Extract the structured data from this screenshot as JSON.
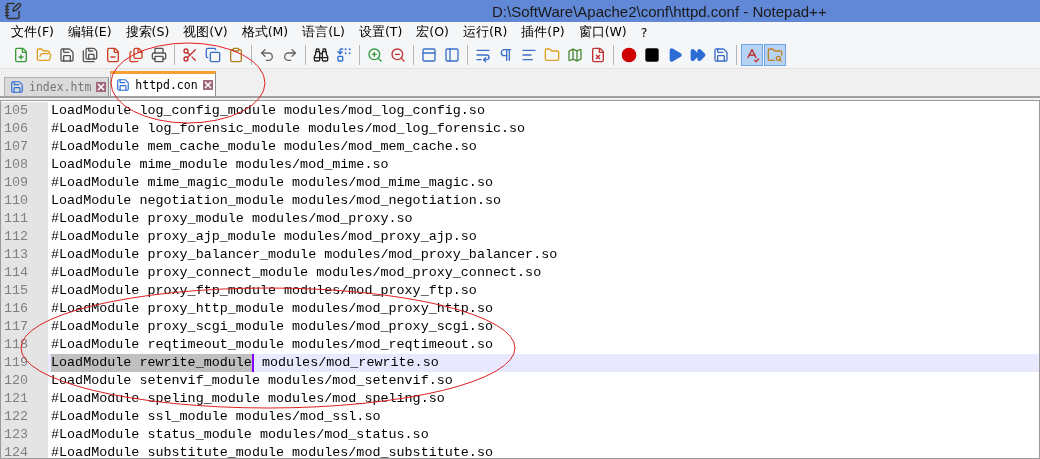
{
  "window": {
    "title": "D:\\SoftWare\\Apache2\\conf\\httpd.conf - Notepad++"
  },
  "menu": [
    "文件(F)",
    "编辑(E)",
    "搜索(S)",
    "视图(V)",
    "格式(M)",
    "语言(L)",
    "设置(T)",
    "宏(O)",
    "运行(R)",
    "插件(P)",
    "窗口(W)",
    "?"
  ],
  "toolbar": [
    {
      "kind": "new",
      "pressed": false
    },
    {
      "kind": "open",
      "pressed": false
    },
    {
      "kind": "save",
      "pressed": false
    },
    {
      "kind": "save-all",
      "pressed": false
    },
    {
      "kind": "close",
      "pressed": false
    },
    {
      "kind": "close-all",
      "pressed": false
    },
    {
      "kind": "print",
      "pressed": false
    },
    {
      "kind": "separator"
    },
    {
      "kind": "cut",
      "pressed": false
    },
    {
      "kind": "copy",
      "pressed": false
    },
    {
      "kind": "paste",
      "pressed": false
    },
    {
      "kind": "separator"
    },
    {
      "kind": "undo",
      "pressed": false
    },
    {
      "kind": "redo",
      "pressed": false
    },
    {
      "kind": "separator"
    },
    {
      "kind": "find",
      "pressed": false
    },
    {
      "kind": "replace",
      "pressed": false
    },
    {
      "kind": "separator"
    },
    {
      "kind": "zoom-in",
      "pressed": false
    },
    {
      "kind": "zoom-out",
      "pressed": false
    },
    {
      "kind": "separator"
    },
    {
      "kind": "sync-vertical",
      "pressed": false
    },
    {
      "kind": "sync-horizontal",
      "pressed": false
    },
    {
      "kind": "separator"
    },
    {
      "kind": "wrap",
      "pressed": false
    },
    {
      "kind": "all-chars",
      "pressed": false
    },
    {
      "kind": "indent-guide",
      "pressed": false
    },
    {
      "kind": "language",
      "pressed": false
    },
    {
      "kind": "doc-map",
      "pressed": false
    },
    {
      "kind": "function-list",
      "pressed": false
    },
    {
      "kind": "separator"
    },
    {
      "kind": "record",
      "pressed": false
    },
    {
      "kind": "stop",
      "pressed": false
    },
    {
      "kind": "play",
      "pressed": false
    },
    {
      "kind": "play-multiple",
      "pressed": false
    },
    {
      "kind": "save-macro",
      "pressed": false
    },
    {
      "kind": "separator"
    },
    {
      "kind": "spellcheck",
      "pressed": true
    },
    {
      "kind": "folder",
      "pressed": true
    }
  ],
  "tabs": [
    {
      "label": "index.htm",
      "selected": false
    },
    {
      "label": "httpd.con",
      "selected": true
    }
  ],
  "editor": {
    "lines": [
      {
        "number": "105",
        "current": false,
        "parts": [
          {
            "text": "LoadModule log_config_module modules/mod_log_config.so",
            "selected": false
          }
        ]
      },
      {
        "number": "106",
        "current": false,
        "parts": [
          {
            "text": "#LoadModule log_forensic_module modules/mod_log_forensic.so",
            "selected": false
          }
        ]
      },
      {
        "number": "107",
        "current": false,
        "parts": [
          {
            "text": "#LoadModule mem_cache_module modules/mod_mem_cache.so",
            "selected": false
          }
        ]
      },
      {
        "number": "108",
        "current": false,
        "parts": [
          {
            "text": "LoadModule mime_module modules/mod_mime.so",
            "selected": false
          }
        ]
      },
      {
        "number": "109",
        "current": false,
        "parts": [
          {
            "text": "#LoadModule mime_magic_module modules/mod_mime_magic.so",
            "selected": false
          }
        ]
      },
      {
        "number": "110",
        "current": false,
        "parts": [
          {
            "text": "LoadModule negotiation_module modules/mod_negotiation.so",
            "selected": false
          }
        ]
      },
      {
        "number": "111",
        "current": false,
        "parts": [
          {
            "text": "#LoadModule proxy_module modules/mod_proxy.so",
            "selected": false
          }
        ]
      },
      {
        "number": "112",
        "current": false,
        "parts": [
          {
            "text": "#LoadModule proxy_ajp_module modules/mod_proxy_ajp.so",
            "selected": false
          }
        ]
      },
      {
        "number": "113",
        "current": false,
        "parts": [
          {
            "text": "#LoadModule proxy_balancer_module modules/mod_proxy_balancer.so",
            "selected": false
          }
        ]
      },
      {
        "number": "114",
        "current": false,
        "parts": [
          {
            "text": "#LoadModule proxy_connect_module modules/mod_proxy_connect.so",
            "selected": false
          }
        ]
      },
      {
        "number": "115",
        "current": false,
        "parts": [
          {
            "text": "#LoadModule proxy_ftp_module modules/mod_proxy_ftp.so",
            "selected": false
          }
        ]
      },
      {
        "number": "116",
        "current": false,
        "parts": [
          {
            "text": "#LoadModule proxy_http_module modules/mod_proxy_http.so",
            "selected": false
          }
        ]
      },
      {
        "number": "117",
        "current": false,
        "parts": [
          {
            "text": "#LoadModule proxy_scgi_module modules/mod_proxy_scgi.so",
            "selected": false
          }
        ]
      },
      {
        "number": "118",
        "current": false,
        "parts": [
          {
            "text": "#LoadModule reqtimeout_module modules/mod_reqtimeout.so",
            "selected": false
          }
        ]
      },
      {
        "number": "119",
        "current": true,
        "parts": [
          {
            "text": "LoadModule rewrite_module",
            "selected": true
          },
          {
            "text": " modules/mod_rewrite.so",
            "selected": false
          }
        ]
      },
      {
        "number": "120",
        "current": false,
        "parts": [
          {
            "text": "LoadModule setenvif_module modules/mod_setenvif.so",
            "selected": false
          }
        ]
      },
      {
        "number": "121",
        "current": false,
        "parts": [
          {
            "text": "#LoadModule speling_module modules/mod_speling.so",
            "selected": false
          }
        ]
      },
      {
        "number": "122",
        "current": false,
        "parts": [
          {
            "text": "#LoadModule ssl_module modules/mod_ssl.so",
            "selected": false
          }
        ]
      },
      {
        "number": "123",
        "current": false,
        "parts": [
          {
            "text": "#LoadModule status_module modules/mod_status.so",
            "selected": false
          }
        ]
      },
      {
        "number": "124",
        "current": false,
        "parts": [
          {
            "text": "#LoadModule substitute_module modules/mod_substitute.so",
            "selected": false
          }
        ]
      }
    ]
  }
}
